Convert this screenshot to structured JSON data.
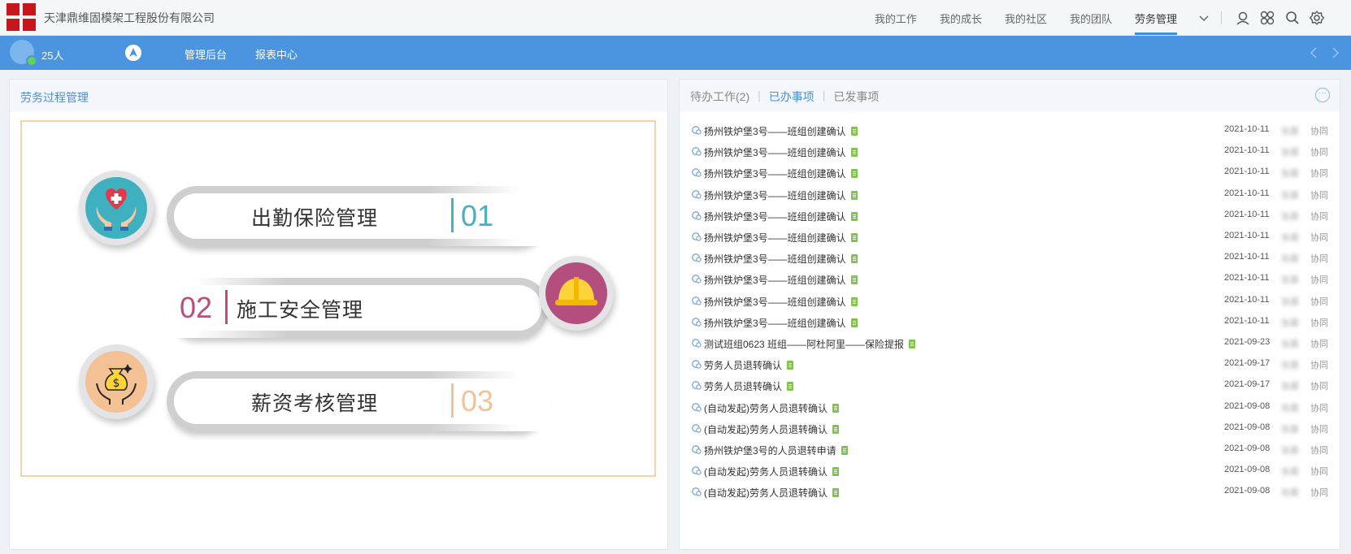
{
  "header": {
    "company": "天津鼎维固模架工程股份有限公司",
    "nav": [
      "我的工作",
      "我的成长",
      "我的社区",
      "我的团队",
      "劳务管理"
    ],
    "active_nav": "劳务管理",
    "icons": [
      "chevron-down-icon",
      "user-icon",
      "apps-icon",
      "search-icon",
      "settings-icon"
    ]
  },
  "subbar": {
    "people_count": "25人",
    "links": [
      "管理后台",
      "报表中心"
    ]
  },
  "left_panel": {
    "title": "劳务过程管理",
    "items": [
      {
        "label": "出勤保险管理",
        "number": "01",
        "color": "#4aaec4"
      },
      {
        "label": "施工安全管理",
        "number": "02",
        "color": "#b94f7d"
      },
      {
        "label": "薪资考核管理",
        "number": "03",
        "color": "#f1c39a"
      }
    ]
  },
  "right_panel": {
    "tabs": [
      "待办工作(2)",
      "已办事项",
      "已发事项"
    ],
    "active_tab": "已办事项",
    "rows": [
      {
        "title": "扬州铁炉堡3号——班组创建确认",
        "date": "2021-10-11",
        "name": "张晨",
        "type": "协同"
      },
      {
        "title": "扬州铁炉堡3号——班组创建确认",
        "date": "2021-10-11",
        "name": "张晨",
        "type": "协同"
      },
      {
        "title": "扬州铁炉堡3号——班组创建确认",
        "date": "2021-10-11",
        "name": "张晨",
        "type": "协同"
      },
      {
        "title": "扬州铁炉堡3号——班组创建确认",
        "date": "2021-10-11",
        "name": "张晨",
        "type": "协同"
      },
      {
        "title": "扬州铁炉堡3号——班组创建确认",
        "date": "2021-10-11",
        "name": "张晨",
        "type": "协同"
      },
      {
        "title": "扬州铁炉堡3号——班组创建确认",
        "date": "2021-10-11",
        "name": "张晨",
        "type": "协同"
      },
      {
        "title": "扬州铁炉堡3号——班组创建确认",
        "date": "2021-10-11",
        "name": "张晨",
        "type": "协同"
      },
      {
        "title": "扬州铁炉堡3号——班组创建确认",
        "date": "2021-10-11",
        "name": "张晨",
        "type": "协同"
      },
      {
        "title": "扬州铁炉堡3号——班组创建确认",
        "date": "2021-10-11",
        "name": "张晨",
        "type": "协同"
      },
      {
        "title": "扬州铁炉堡3号——班组创建确认",
        "date": "2021-10-11",
        "name": "张晨",
        "type": "协同"
      },
      {
        "title": "测试班组0623 班组——阿杜阿里——保险提报",
        "date": "2021-09-23",
        "name": "张晨",
        "type": "协同"
      },
      {
        "title": "劳务人员退转确认",
        "date": "2021-09-17",
        "name": "张晨",
        "type": "协同"
      },
      {
        "title": "劳务人员退转确认",
        "date": "2021-09-17",
        "name": "张晨",
        "type": "协同"
      },
      {
        "title": "(自动发起)劳务人员退转确认",
        "date": "2021-09-08",
        "name": "张晨",
        "type": "协同"
      },
      {
        "title": "(自动发起)劳务人员退转确认",
        "date": "2021-09-08",
        "name": "张晨",
        "type": "协同"
      },
      {
        "title": "扬州铁炉堡3号的人员退转申请",
        "date": "2021-09-08",
        "name": "张晨",
        "type": "协同"
      },
      {
        "title": "(自动发起)劳务人员退转确认",
        "date": "2021-09-08",
        "name": "张晨",
        "type": "协同"
      },
      {
        "title": "(自动发起)劳务人员退转确认",
        "date": "2021-09-08",
        "name": "张晨",
        "type": "协同"
      }
    ]
  }
}
